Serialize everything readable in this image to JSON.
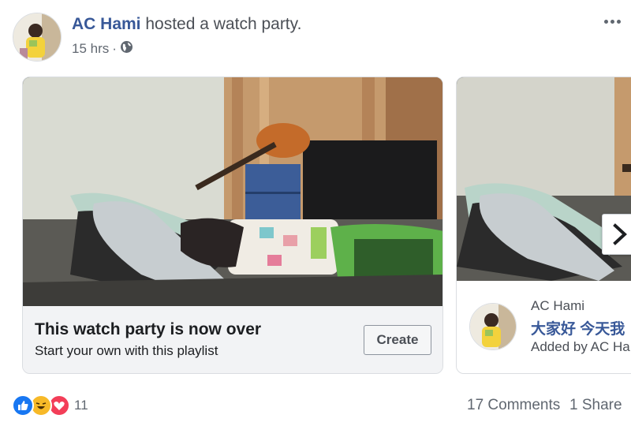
{
  "post": {
    "author_name": "AC Hami",
    "action_text": " hosted a watch party.",
    "time": "15 hrs",
    "separator": "·",
    "privacy_icon": "globe-icon",
    "more_icon": "more-options-icon"
  },
  "cards": [
    {
      "status_title": "This watch party is now over",
      "status_subtitle": "Start your own with this playlist",
      "button_label": "Create"
    },
    {
      "author": "AC Hami",
      "title": "大家好 今天我",
      "added_by": "Added by AC Ha"
    }
  ],
  "carousel": {
    "next_icon": "chevron-right-icon"
  },
  "footer": {
    "reactions": [
      "like-icon",
      "haha-icon",
      "love-icon"
    ],
    "reaction_count": "11",
    "comments": "17 Comments",
    "shares": "1 Share"
  },
  "colors": {
    "link": "#385898",
    "muted": "#606770",
    "like": "#1877f2",
    "haha": "#f7b928",
    "love": "#f33e58"
  }
}
